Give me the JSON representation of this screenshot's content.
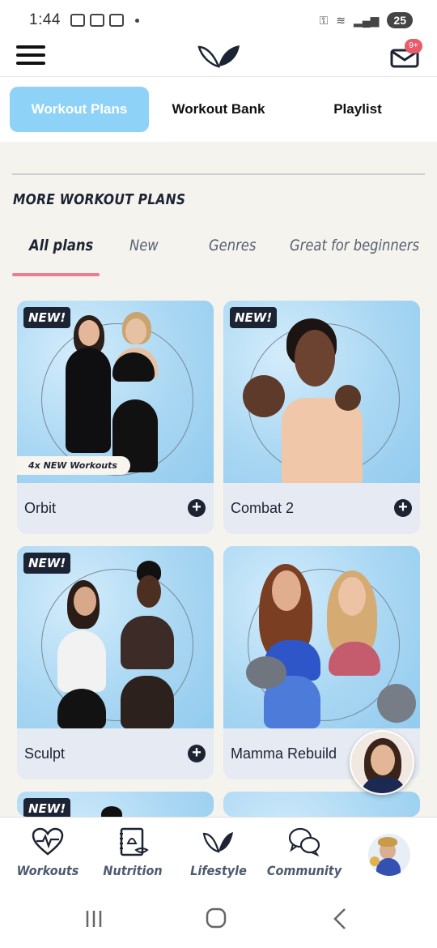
{
  "status_bar": {
    "time": "1:44",
    "battery": "25"
  },
  "header": {
    "mail_badge": "9+"
  },
  "top_tabs": [
    {
      "label": "Workout Plans",
      "active": true
    },
    {
      "label": "Workout Bank",
      "active": false
    },
    {
      "label": "Playlist",
      "active": false
    }
  ],
  "section": {
    "title": "MORE WORKOUT PLANS"
  },
  "filters": [
    {
      "label": "All plans",
      "active": true
    },
    {
      "label": "New",
      "active": false
    },
    {
      "label": "Genres",
      "active": false
    },
    {
      "label": "Great for beginners",
      "active": false
    }
  ],
  "cards": [
    {
      "title": "Orbit",
      "badge": "NEW!",
      "pill": "4x NEW Workouts"
    },
    {
      "title": "Combat 2",
      "badge": "NEW!"
    },
    {
      "title": "Sculpt",
      "badge": "NEW!"
    },
    {
      "title": "Mamma Rebuild",
      "badge": ""
    },
    {
      "title": "",
      "badge": "NEW!"
    },
    {
      "title": "",
      "badge": ""
    }
  ],
  "bottom_nav": [
    {
      "label": "Workouts",
      "icon": "heart-pulse-icon"
    },
    {
      "label": "Nutrition",
      "icon": "recipe-book-icon"
    },
    {
      "label": "Lifestyle",
      "icon": "leaf-icon"
    },
    {
      "label": "Community",
      "icon": "chat-bubbles-icon"
    }
  ],
  "colors": {
    "accent": "#8fd2f7",
    "underline": "#ef7c8a",
    "navy": "#1c2333"
  }
}
